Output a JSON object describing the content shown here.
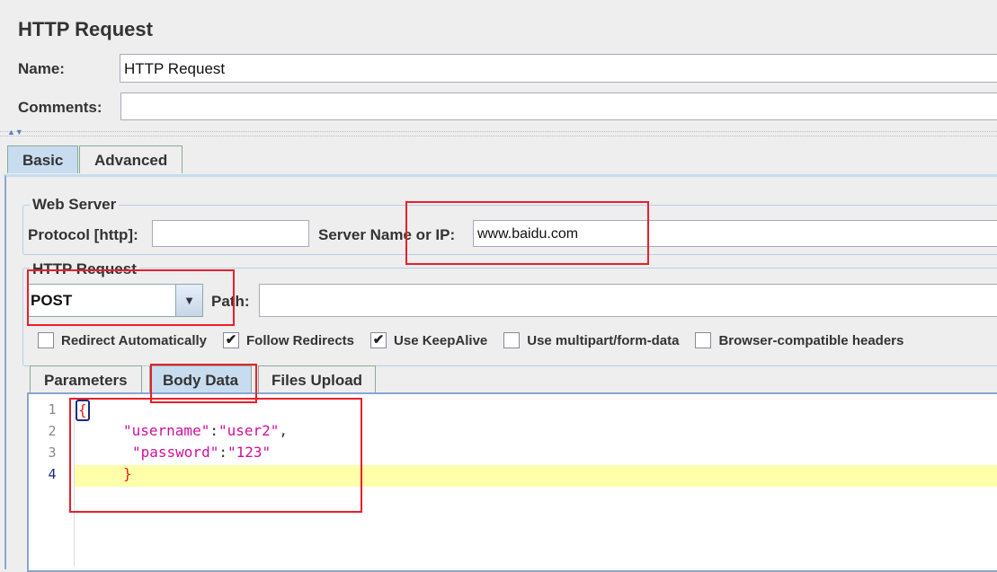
{
  "header": {
    "title": "HTTP Request",
    "name_label": "Name:",
    "name_value": "HTTP Request",
    "comments_label": "Comments:",
    "comments_value": ""
  },
  "tabs": [
    {
      "label": "Basic",
      "selected": true
    },
    {
      "label": "Advanced",
      "selected": false
    }
  ],
  "web_server": {
    "legend": "Web Server",
    "protocol_label": "Protocol [http]:",
    "protocol_value": "",
    "server_label": "Server Name or IP:",
    "server_value": "www.baidu.com"
  },
  "http_request": {
    "legend": "HTTP Request",
    "method": "POST",
    "path_label": "Path:",
    "path_value": ""
  },
  "checkboxes": [
    {
      "label": "Redirect Automatically",
      "checked": false
    },
    {
      "label": "Follow Redirects",
      "checked": true
    },
    {
      "label": "Use KeepAlive",
      "checked": true
    },
    {
      "label": "Use multipart/form-data",
      "checked": false
    },
    {
      "label": "Browser-compatible headers",
      "checked": false
    }
  ],
  "sub_tabs": [
    {
      "label": "Parameters",
      "selected": false
    },
    {
      "label": "Body Data",
      "selected": true
    },
    {
      "label": "Files Upload",
      "selected": false
    }
  ],
  "editor": {
    "line_numbers": [
      "1",
      "2",
      "3",
      "4"
    ],
    "open_brace": "{",
    "key1": "\"username\"",
    "val1": "\"user2\"",
    "key2": "\"password\"",
    "val2": "\"123\"",
    "colon": ":",
    "comma": ",",
    "close_brace": "}"
  },
  "colors": {
    "highlight_red": "#e8202a",
    "selected_tab": "#c8dcf0",
    "string": "#d0109a",
    "current_line": "#ffffaa"
  }
}
